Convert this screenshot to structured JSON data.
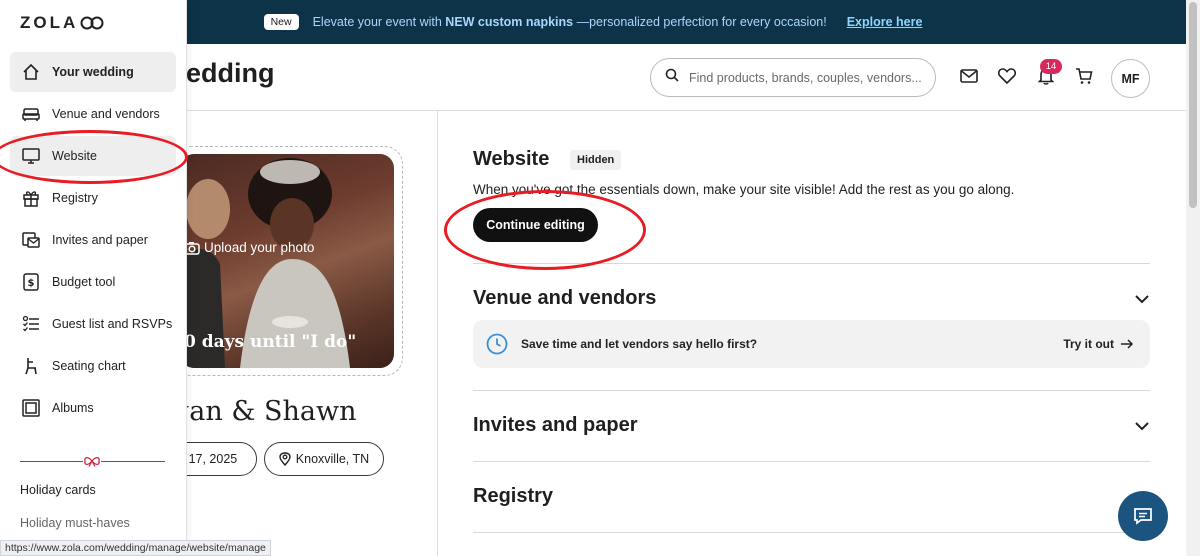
{
  "banner": {
    "badge": "New",
    "message_pre": "Elevate your event with ",
    "message_bold": "NEW custom napkins",
    "message_post": " —personalized perfection for every occasion!",
    "link": "Explore here"
  },
  "header": {
    "title": "edding",
    "search_placeholder": "Find products, brands, couples, vendors...",
    "notification_count": "14",
    "avatar_initials": "MF",
    "icons": [
      "search-icon",
      "mail-icon",
      "heart-icon",
      "bell-icon",
      "cart-icon"
    ]
  },
  "sidebar": {
    "logo": "ZOLA",
    "items": [
      {
        "label": "Your wedding",
        "icon": "home-icon",
        "active": true
      },
      {
        "label": "Venue and vendors",
        "icon": "sofa-icon",
        "active": false
      },
      {
        "label": "Website",
        "icon": "monitor-icon",
        "active": false
      },
      {
        "label": "Registry",
        "icon": "gift-icon",
        "active": false
      },
      {
        "label": "Invites and paper",
        "icon": "envelope-icon",
        "active": false
      },
      {
        "label": "Budget tool",
        "icon": "dollar-icon",
        "active": false
      },
      {
        "label": "Guest list and RSVPs",
        "icon": "list-icon",
        "active": false
      },
      {
        "label": "Seating chart",
        "icon": "chair-icon",
        "active": false
      },
      {
        "label": "Albums",
        "icon": "album-icon",
        "active": false
      }
    ],
    "extra_links": [
      "Holiday cards",
      "Holiday must-haves"
    ]
  },
  "card": {
    "upload_label": "Upload your photo",
    "countdown": "0 days until \"I do\"",
    "couple_names": "gan & Shawn",
    "date": "er 17, 2025",
    "location": "Knoxville, TN"
  },
  "website": {
    "title": "Website",
    "badge": "Hidden",
    "description": "When you've got the essentials down, make your site visible! Add the rest as you go along.",
    "button": "Continue editing"
  },
  "sections": {
    "venue": "Venue and vendors",
    "venue_tip": "Save time and let vendors say hello first?",
    "venue_tip_action": "Try it out",
    "invites": "Invites and paper",
    "registry": "Registry"
  },
  "status_url": "https://www.zola.com/wedding/manage/website/manage",
  "colors": {
    "banner_bg": "#0d3349",
    "accent_red": "#e81c24",
    "badge_pink": "#d8285d",
    "chat_blue": "#1c5480"
  }
}
